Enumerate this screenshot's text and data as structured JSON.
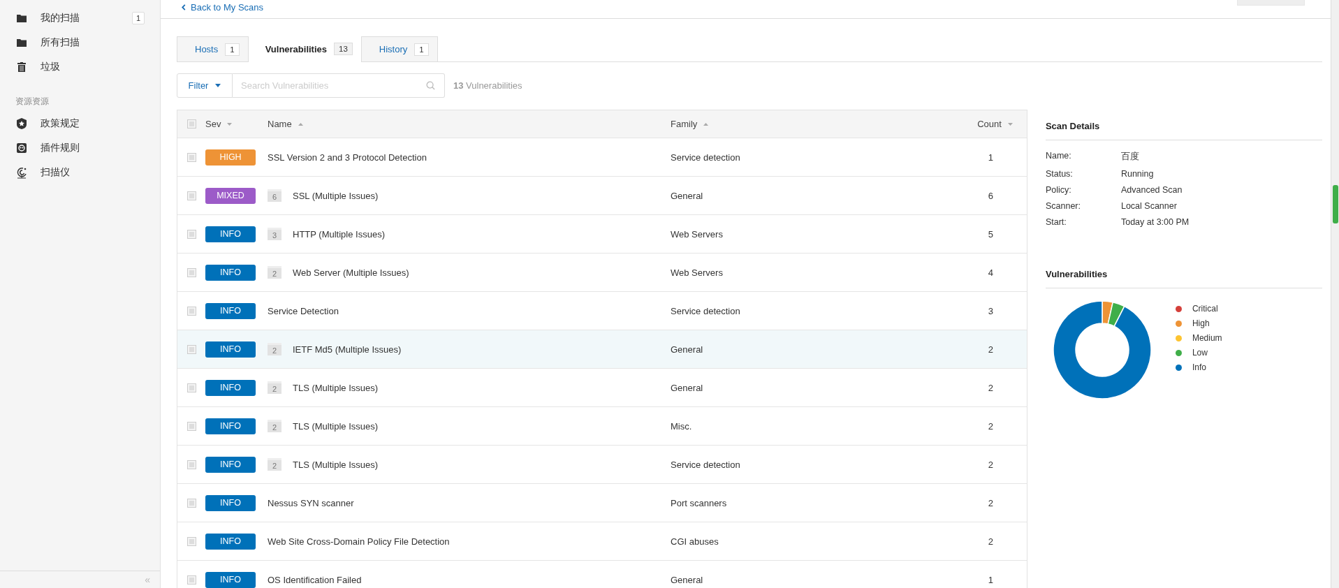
{
  "sidebar": {
    "items": [
      {
        "kind": "folder",
        "label": "我的扫描",
        "badge": "1"
      },
      {
        "kind": "folder",
        "label": "所有扫描"
      },
      {
        "kind": "trash",
        "label": "垃圾"
      }
    ],
    "section_heading": "资源资源",
    "resources": [
      {
        "kind": "shield",
        "label": "政策规定"
      },
      {
        "kind": "plugin",
        "label": "插件规则"
      },
      {
        "kind": "radar",
        "label": "扫描仪"
      }
    ],
    "collapse": "«"
  },
  "back_link": "Back to My Scans",
  "tabs": [
    {
      "label": "Hosts",
      "count": "1",
      "selected": false
    },
    {
      "label": "Vulnerabilities",
      "count": "13",
      "selected": true
    },
    {
      "label": "History",
      "count": "1",
      "selected": false
    }
  ],
  "filter": {
    "label": "Filter",
    "search_placeholder": "Search Vulnerabilities",
    "result_count": "13",
    "result_label": "Vulnerabilities"
  },
  "table": {
    "header_checked": false,
    "columns": [
      {
        "label": "Sev",
        "kind": "desc"
      },
      {
        "label": "Name",
        "kind": "asc"
      },
      {
        "label": "Family",
        "kind": "asc"
      },
      {
        "label": "Count",
        "kind": "desc"
      }
    ],
    "rows": [
      {
        "kind": "high",
        "sev": "HIGH",
        "name": "SSL Version 2 and 3 Protocol Detection",
        "family": "Service detection",
        "count": "1",
        "checked": false,
        "selected": false
      },
      {
        "kind": "mixed",
        "sev": "MIXED",
        "group": "6",
        "name": "SSL (Multiple Issues)",
        "family": "General",
        "count": "6",
        "checked": false,
        "selected": false
      },
      {
        "kind": "info",
        "sev": "INFO",
        "group": "3",
        "name": "HTTP (Multiple Issues)",
        "family": "Web Servers",
        "count": "5",
        "checked": false,
        "selected": false
      },
      {
        "kind": "info",
        "sev": "INFO",
        "group": "2",
        "name": "Web Server (Multiple Issues)",
        "family": "Web Servers",
        "count": "4",
        "checked": false,
        "selected": false
      },
      {
        "kind": "info",
        "sev": "INFO",
        "name": "Service Detection",
        "family": "Service detection",
        "count": "3",
        "checked": false,
        "selected": false
      },
      {
        "kind": "info",
        "sev": "INFO",
        "group": "2",
        "name": "IETF Md5 (Multiple Issues)",
        "family": "General",
        "count": "2",
        "checked": false,
        "selected": true
      },
      {
        "kind": "info",
        "sev": "INFO",
        "group": "2",
        "name": "TLS (Multiple Issues)",
        "family": "General",
        "count": "2",
        "checked": false,
        "selected": false
      },
      {
        "kind": "info",
        "sev": "INFO",
        "group": "2",
        "name": "TLS (Multiple Issues)",
        "family": "Misc.",
        "count": "2",
        "checked": false,
        "selected": false
      },
      {
        "kind": "info",
        "sev": "INFO",
        "group": "2",
        "name": "TLS (Multiple Issues)",
        "family": "Service detection",
        "count": "2",
        "checked": false,
        "selected": false
      },
      {
        "kind": "info",
        "sev": "INFO",
        "name": "Nessus SYN scanner",
        "family": "Port scanners",
        "count": "2",
        "checked": false,
        "selected": false
      },
      {
        "kind": "info",
        "sev": "INFO",
        "name": "Web Site Cross-Domain Policy File Detection",
        "family": "CGI abuses",
        "count": "2",
        "checked": false,
        "selected": false
      },
      {
        "kind": "info",
        "sev": "INFO",
        "name": "OS Identification Failed",
        "family": "General",
        "count": "1",
        "checked": false,
        "selected": false
      }
    ]
  },
  "scan_details": {
    "title": "Scan Details",
    "fields": [
      {
        "label": "Name:",
        "value": "百度"
      },
      {
        "label": "Status:",
        "value": "Running"
      },
      {
        "label": "Policy:",
        "value": "Advanced Scan"
      },
      {
        "label": "Scanner:",
        "value": "Local Scanner"
      },
      {
        "label": "Start:",
        "value": "Today at 3:00 PM"
      }
    ]
  },
  "vulnerabilities": {
    "title": "Vulnerabilities",
    "legend": [
      {
        "label": "Critical",
        "color": "#d43f3a"
      },
      {
        "label": "High",
        "color": "#ee9336"
      },
      {
        "label": "Medium",
        "color": "#fdc431"
      },
      {
        "label": "Low",
        "color": "#3fae49"
      },
      {
        "label": "Info",
        "color": "#0071b9"
      }
    ]
  }
}
